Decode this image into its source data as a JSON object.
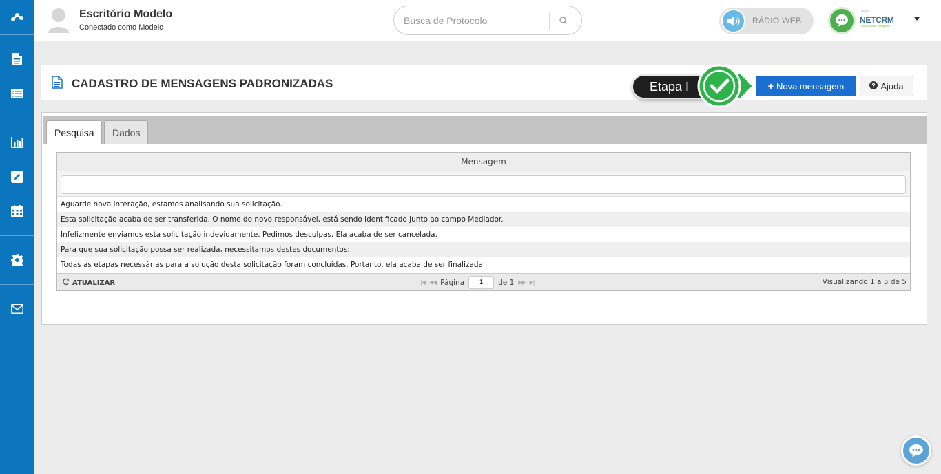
{
  "header": {
    "company": "Escritório Modelo",
    "connected": "Conectado como Modelo",
    "search_placeholder": "Busca de Protocolo",
    "radio_label": "RÁDIO WEB",
    "brand_small": "Grupo",
    "brand_name": "NETCRM",
    "brand_sub": "Comunicação inteligente"
  },
  "sidebar": {
    "items": [
      "logo-icon",
      "document-icon",
      "list-icon",
      "chart-icon",
      "edit-icon",
      "calendar-icon",
      "gear-icon",
      "mail-icon"
    ]
  },
  "page": {
    "title": "CADASTRO DE MENSAGENS PADRONIZADAS",
    "etapa_label": "Etapa I",
    "new_button": "Nova mensagem",
    "help_button": "Ajuda"
  },
  "tabs": [
    {
      "label": "Pesquisa",
      "active": true
    },
    {
      "label": "Dados",
      "active": false
    }
  ],
  "grid": {
    "column": "Mensagem",
    "rows": [
      "Aguarde nova interação, estamos analisando sua solicitação.",
      "Esta solicitação acaba de ser transferida. O nome do novo responsável, está sendo identificado junto ao campo Mediador.",
      "Infelizmente enviamos esta solicitação indevidamente. Pedimos desculpas. Ela acaba de ser cancelada.",
      "Para que sua solicitação possa ser realizada, necessitamos destes documentos:",
      "Todas as etapas necessárias para a solução desta solicitação foram concluídas. Portanto, ela acaba de ser finalizada"
    ],
    "footer": {
      "refresh": "ATUALIZAR",
      "page_label": "Página",
      "page_value": "1",
      "page_of": "de 1",
      "viewing": "Visualizando 1 a 5 de 5"
    }
  },
  "colors": {
    "sidebar": "#0b76bd",
    "primary_button": "#1b6fd1",
    "check_green": "#2db34a"
  }
}
